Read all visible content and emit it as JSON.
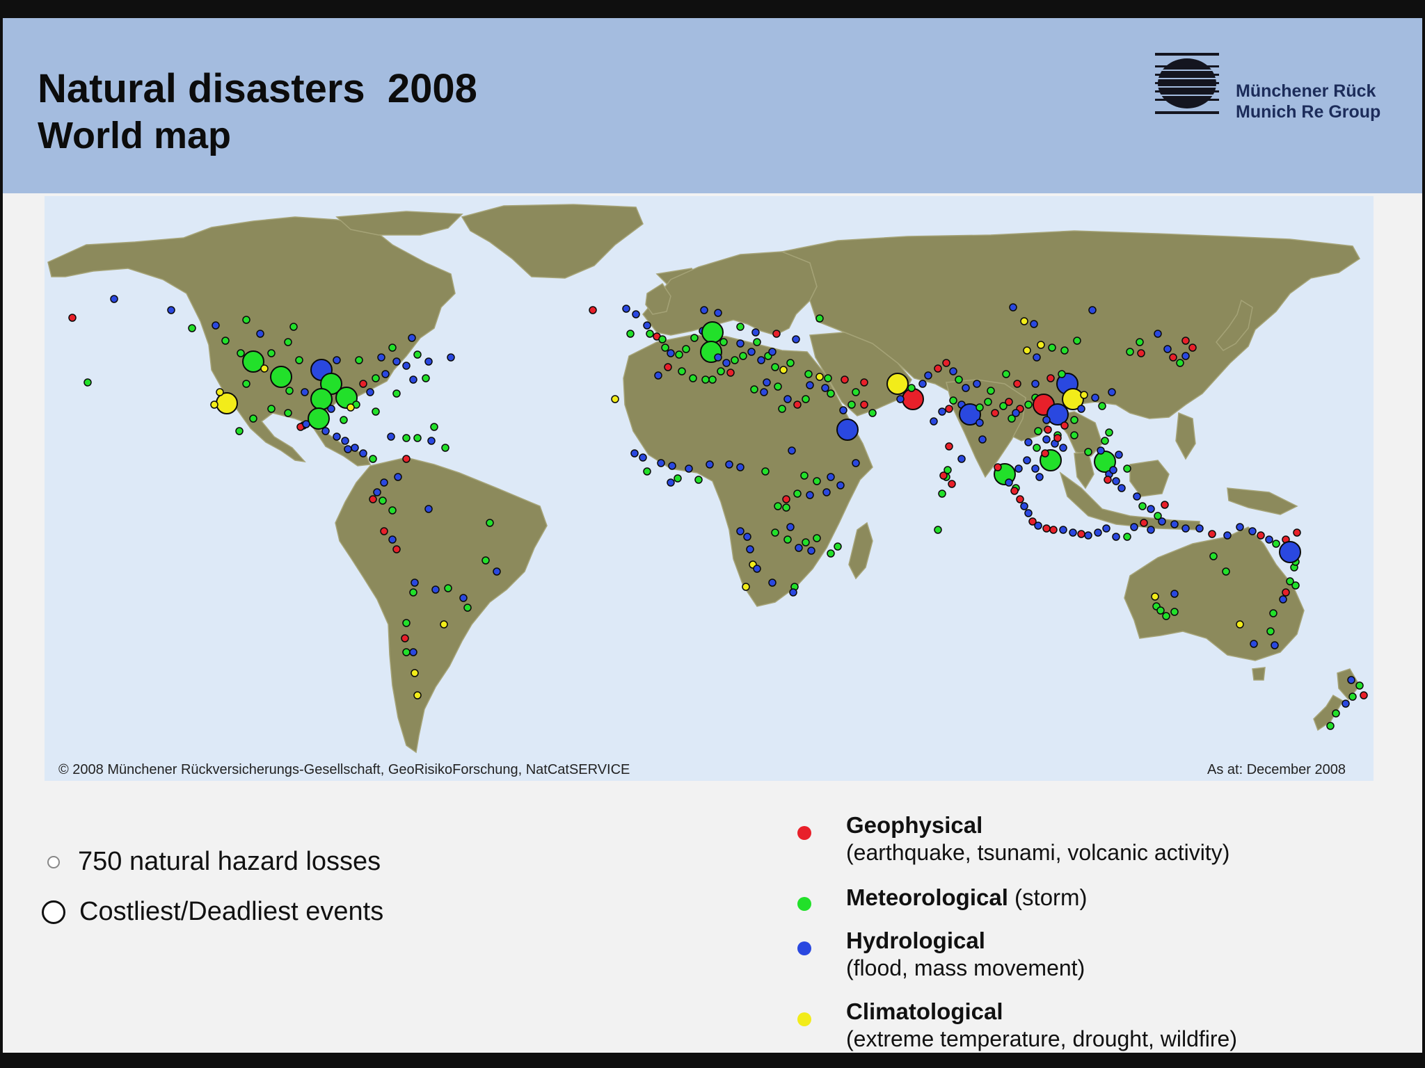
{
  "header": {
    "title": "Natural disasters  2008",
    "subtitle": "World map"
  },
  "logo": {
    "line1": "Münchener Rück",
    "line2": "Munich Re Group"
  },
  "map": {
    "copyright": "© 2008 Münchener Rückversicherungs-Gesellschaft, GeoRisikoForschung, NatCatSERVICE",
    "as_at": "As at: December 2008",
    "ocean_color": "#dde9f7",
    "land_color": "#8c8a5c"
  },
  "key": {
    "small": "750 natural hazard losses",
    "large": "Costliest/Deadliest events"
  },
  "legend": {
    "geophysical": {
      "title": "Geophysical",
      "desc": "(earthquake, tsunami, volcanic activity)",
      "color": "#e8202a"
    },
    "meteorological": {
      "title": "Meteorological",
      "desc": "(storm)",
      "color": "#22e02a"
    },
    "hydrological": {
      "title": "Hydrological",
      "desc": "(flood, mass movement)",
      "color": "#2a48e0"
    },
    "climatological": {
      "title": "Climatological",
      "desc": "(extreme temperature, drought, wildfire)",
      "color": "#f2ec1a"
    }
  }
}
